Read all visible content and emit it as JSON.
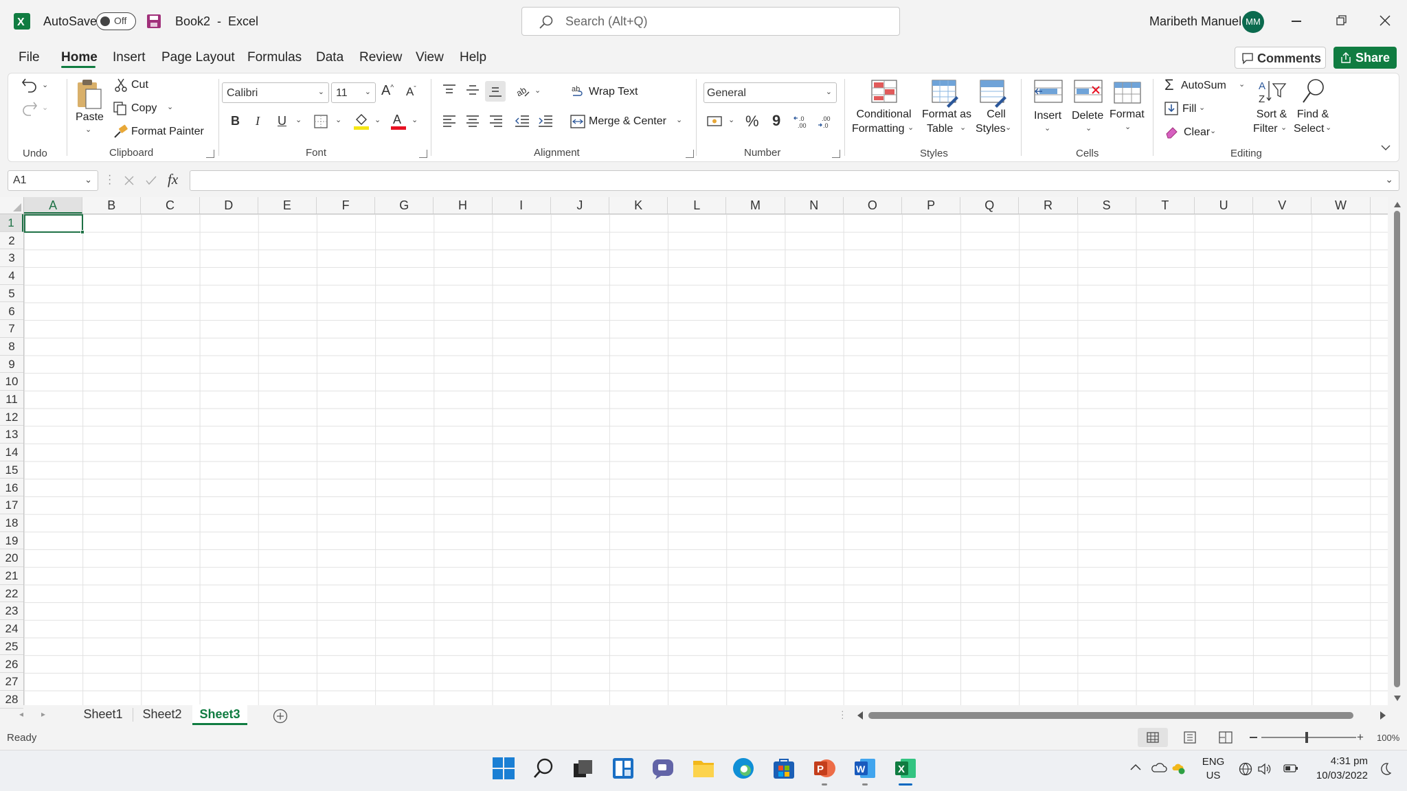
{
  "titlebar": {
    "autosave_label": "AutoSave",
    "autosave_state": "Off",
    "doc_title": "Book2  -  Excel",
    "search_placeholder": "Search (Alt+Q)",
    "user_name": "Maribeth Manuel",
    "user_initials": "MM"
  },
  "menu": {
    "tabs": [
      "File",
      "Home",
      "Insert",
      "Page Layout",
      "Formulas",
      "Data",
      "Review",
      "View",
      "Help"
    ],
    "active": "Home",
    "comments_label": "Comments",
    "share_label": "Share"
  },
  "ribbon": {
    "clipboard": {
      "paste": "Paste",
      "cut": "Cut",
      "copy": "Copy",
      "format_painter": "Format Painter",
      "group": "Clipboard"
    },
    "undo": {
      "group": "Undo"
    },
    "font": {
      "name": "Calibri",
      "size": "11",
      "group": "Font",
      "bold": "B",
      "italic": "I",
      "underline": "U"
    },
    "alignment": {
      "wrap_text": "Wrap Text",
      "merge_center": "Merge & Center",
      "group": "Alignment"
    },
    "number": {
      "format": "General",
      "percent": "%",
      "comma": "9",
      "group": "Number"
    },
    "styles": {
      "conditional": [
        "Conditional",
        "Formatting"
      ],
      "format_table": [
        "Format as",
        "Table"
      ],
      "cell_styles": [
        "Cell",
        "Styles"
      ],
      "group": "Styles"
    },
    "cells": {
      "insert": "Insert",
      "delete": "Delete",
      "format": "Format",
      "group": "Cells"
    },
    "editing": {
      "autosum": "AutoSum",
      "fill": "Fill",
      "clear": "Clear",
      "sort_filter": [
        "Sort &",
        "Filter"
      ],
      "find_select": [
        "Find &",
        "Select"
      ],
      "group": "Editing"
    }
  },
  "formula_bar": {
    "name_box": "A1",
    "fx": "fx",
    "value": ""
  },
  "grid": {
    "columns": [
      "A",
      "B",
      "C",
      "D",
      "E",
      "F",
      "G",
      "H",
      "I",
      "J",
      "K",
      "L",
      "M",
      "N",
      "O",
      "P",
      "Q",
      "R",
      "S",
      "T",
      "U",
      "V",
      "W"
    ],
    "rows": [
      "1",
      "2",
      "3",
      "4",
      "5",
      "6",
      "7",
      "8",
      "9",
      "10",
      "11",
      "12",
      "13",
      "14",
      "15",
      "16",
      "17",
      "18",
      "19",
      "20",
      "21",
      "22",
      "23",
      "24",
      "25",
      "26",
      "27",
      "28"
    ],
    "active_cell": "A1"
  },
  "sheets": {
    "tabs": [
      "Sheet1",
      "Sheet2",
      "Sheet3"
    ],
    "active": "Sheet3"
  },
  "status": {
    "ready": "Ready",
    "zoom": "100%"
  },
  "taskbar": {
    "lang": "ENG",
    "region": "US",
    "time": "4:31 pm",
    "date": "10/03/2022"
  },
  "colors": {
    "excel_green": "#217346",
    "accent_green": "#107c41",
    "cell_cursor": "#1e7145"
  }
}
